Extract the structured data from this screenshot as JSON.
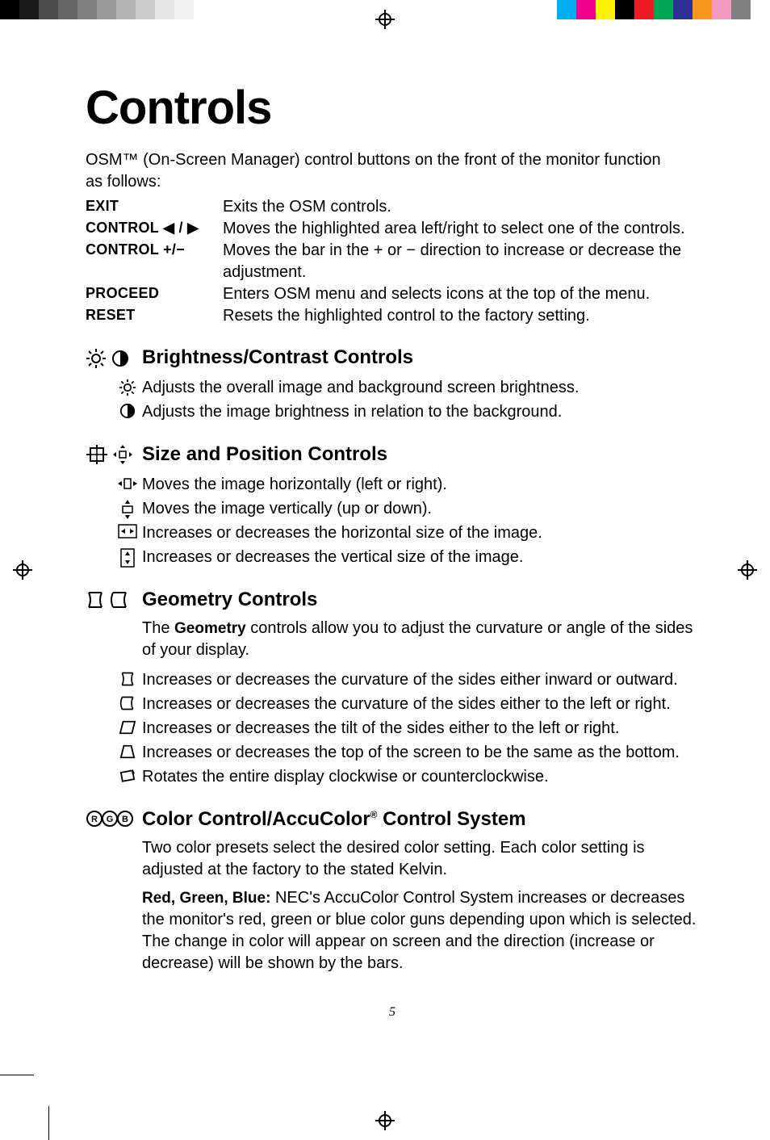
{
  "page_title": "Controls",
  "intro_line1": "OSM™ (On-Screen Manager) control buttons on the front of the monitor function",
  "intro_line2": "as follows:",
  "buttons": {
    "exit": {
      "label": "EXIT",
      "desc": "Exits the OSM controls."
    },
    "ctrl_lr": {
      "label": "CONTROL ◀ / ▶",
      "desc": "Moves the highlighted area left/right to select one of the controls."
    },
    "ctrl_pm": {
      "label": "CONTROL   +/−",
      "desc": "Moves the bar in the + or − direction to increase or decrease the adjustment."
    },
    "proceed": {
      "label": "PROCEED",
      "desc": "Enters OSM menu and selects icons at the top of the menu."
    },
    "reset": {
      "label": "RESET",
      "desc": "Resets the highlighted control to the factory setting."
    }
  },
  "sections": {
    "brightness": {
      "heading": "Brightness/Contrast Controls",
      "items": [
        "Adjusts the overall image and background screen brightness.",
        "Adjusts the image brightness in relation to the background."
      ]
    },
    "sizepos": {
      "heading": "Size and Position Controls",
      "items": [
        "Moves the image horizontally (left or right).",
        "Moves the image vertically (up or down).",
        "Increases or decreases the horizontal size of the image.",
        "Increases or decreases the vertical size of the image."
      ]
    },
    "geometry": {
      "heading": "Geometry Controls",
      "intro_a": "The ",
      "intro_b": "Geometry",
      "intro_c": " controls allow you to adjust the curvature or angle of the sides of your display.",
      "items": [
        "Increases or decreases the curvature of the sides either inward or outward.",
        "Increases or decreases the curvature of the sides either to the left or right.",
        "Increases or decreases the tilt of the sides either to the left or right.",
        "Increases or decreases the top of the screen to be the same as the bottom.",
        "Rotates the entire display clockwise or counterclockwise."
      ]
    },
    "color": {
      "heading_a": "Color Control/AccuColor",
      "heading_b": "®",
      "heading_c": " Control System",
      "para1": "Two color presets select the desired color setting.  Each color setting is adjusted at the factory to the stated Kelvin.",
      "para2_a": "Red, Green, Blue:",
      "para2_b": " NEC's AccuColor Control System increases or decreases the monitor's red, green or blue color guns depending upon which is selected. The change in color will appear on screen and the direction (increase or decrease) will be shown by the bars."
    }
  },
  "page_number": "5",
  "colorbars": {
    "left": [
      "#000000",
      "#1a1a1a",
      "#4d4d4d",
      "#666666",
      "#808080",
      "#999999",
      "#b3b3b3",
      "#cccccc",
      "#e6e6e6",
      "#f2f2f2",
      "#ffffff"
    ],
    "right": [
      "#ffffff",
      "#00aeef",
      "#ec008c",
      "#fff200",
      "#000000",
      "#ed1c24",
      "#00a651",
      "#2e3192",
      "#f7941e",
      "#f49ac1",
      "#808080",
      "#ffffff"
    ]
  }
}
